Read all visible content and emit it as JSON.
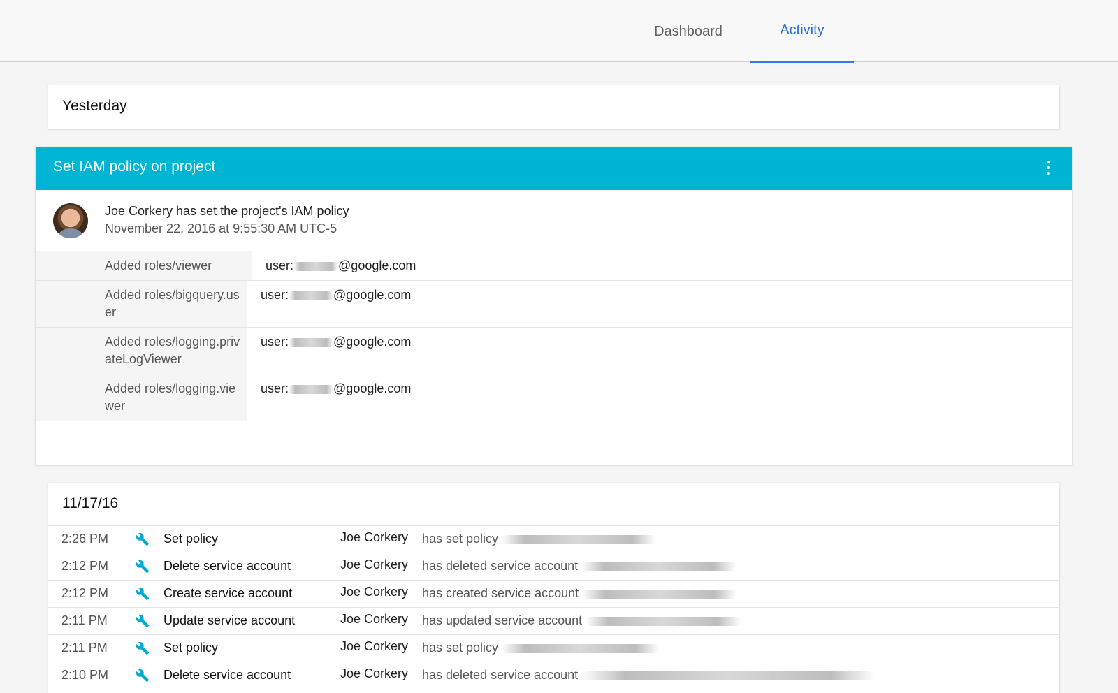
{
  "tabs": [
    {
      "label": "Dashboard",
      "active": false
    },
    {
      "label": "Activity",
      "active": true
    }
  ],
  "accent_color": "#00b4d4",
  "active_tab_color": "#3b78e7",
  "yesterday_card": {
    "label": "Yesterday"
  },
  "iam_card": {
    "title": "Set IAM policy on project",
    "menu_icon": "more-vert-icon",
    "summary": "Joe Corkery has set the project's IAM policy",
    "timestamp": "November 22, 2016 at 9:55:30 AM UTC-5",
    "roles": [
      {
        "role": "Added roles/viewer",
        "user_prefix": "user:",
        "user_suffix": "@google.com"
      },
      {
        "role": "Added roles/bigquery.user",
        "user_prefix": "user:",
        "user_suffix": "@google.com"
      },
      {
        "role": "Added roles/logging.privateLogViewer",
        "user_prefix": "user:",
        "user_suffix": "@google.com"
      },
      {
        "role": "Added roles/logging.viewer",
        "user_prefix": "user:",
        "user_suffix": "@google.com"
      }
    ]
  },
  "activity_list": {
    "date": "11/17/16",
    "icon": "wrench-icon",
    "rows": [
      {
        "time": "2:26 PM",
        "action": "Set policy",
        "actor": "Joe Corkery",
        "detail": "has set policy"
      },
      {
        "time": "2:12 PM",
        "action": "Delete service account",
        "actor": "Joe Corkery",
        "detail": "has deleted service account"
      },
      {
        "time": "2:12 PM",
        "action": "Create service account",
        "actor": "Joe Corkery",
        "detail": "has created service account"
      },
      {
        "time": "2:11 PM",
        "action": "Update service account",
        "actor": "Joe Corkery",
        "detail": "has updated service account"
      },
      {
        "time": "2:11 PM",
        "action": "Set policy",
        "actor": "Joe Corkery",
        "detail": "has set policy"
      },
      {
        "time": "2:10 PM",
        "action": "Delete service account",
        "actor": "Joe Corkery",
        "detail": "has deleted service account"
      }
    ]
  }
}
